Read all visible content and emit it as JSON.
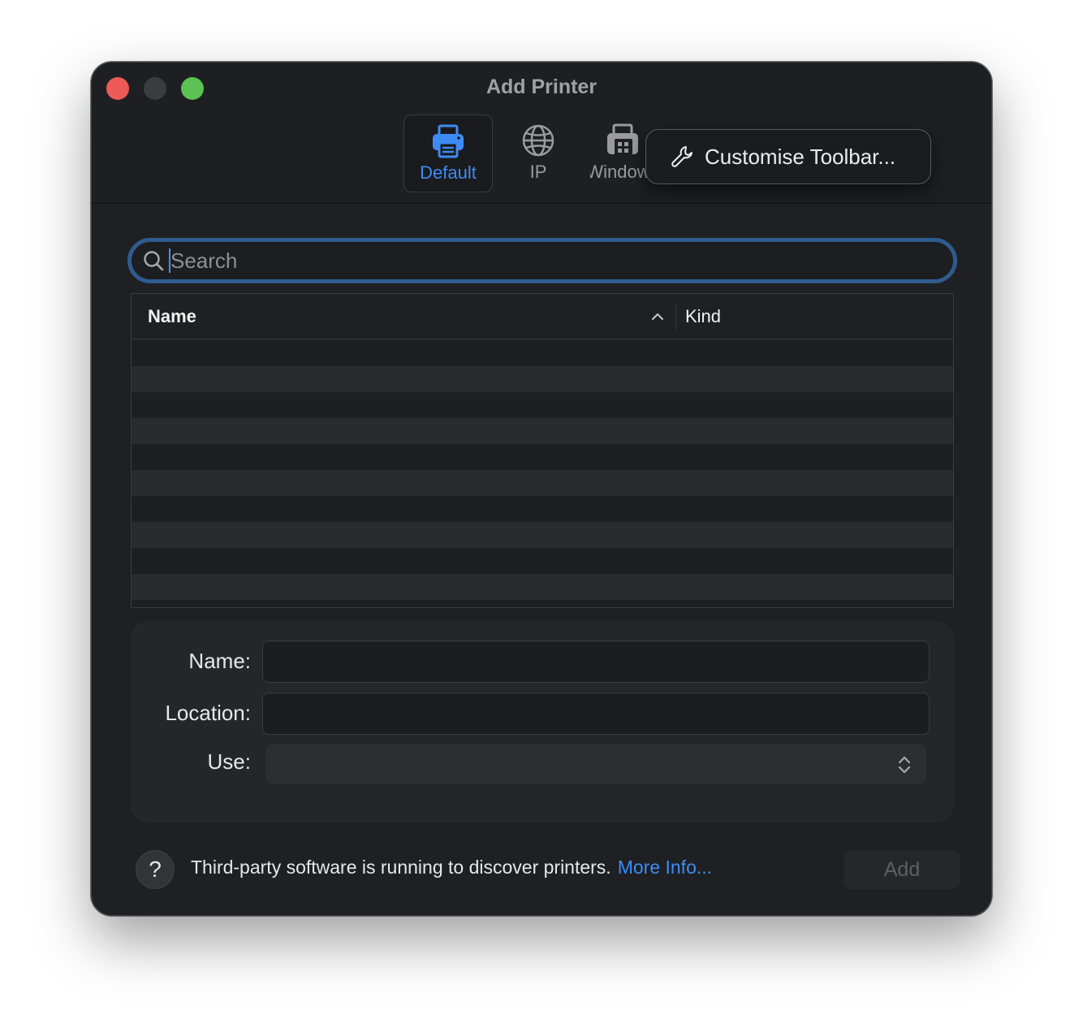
{
  "window": {
    "title": "Add Printer"
  },
  "toolbar": {
    "items": [
      {
        "label": "Default",
        "icon": "printer-icon",
        "selected": true
      },
      {
        "label": "IP",
        "icon": "globe-icon",
        "selected": false
      },
      {
        "label": "Windows",
        "icon": "windows-printer-icon",
        "selected": false
      }
    ]
  },
  "context_menu": {
    "item_label": "Customise Toolbar...",
    "icon": "wrench-icon"
  },
  "search": {
    "placeholder": "Search",
    "value": ""
  },
  "table": {
    "columns": [
      "Name",
      "Kind"
    ],
    "sort_column": "Name",
    "sort_direction": "ascending",
    "rows": []
  },
  "form": {
    "name_label": "Name:",
    "location_label": "Location:",
    "use_label": "Use:",
    "name_value": "",
    "location_value": "",
    "use_value": ""
  },
  "footer": {
    "help_symbol": "?",
    "status_text": "Third-party software is running to discover printers.",
    "more_info_link": "More Info...",
    "add_button": "Add"
  },
  "colors": {
    "accent": "#3d8cf5",
    "close": "#ee5a55",
    "maximize": "#5cc253",
    "window_bg": "#1f2023"
  }
}
